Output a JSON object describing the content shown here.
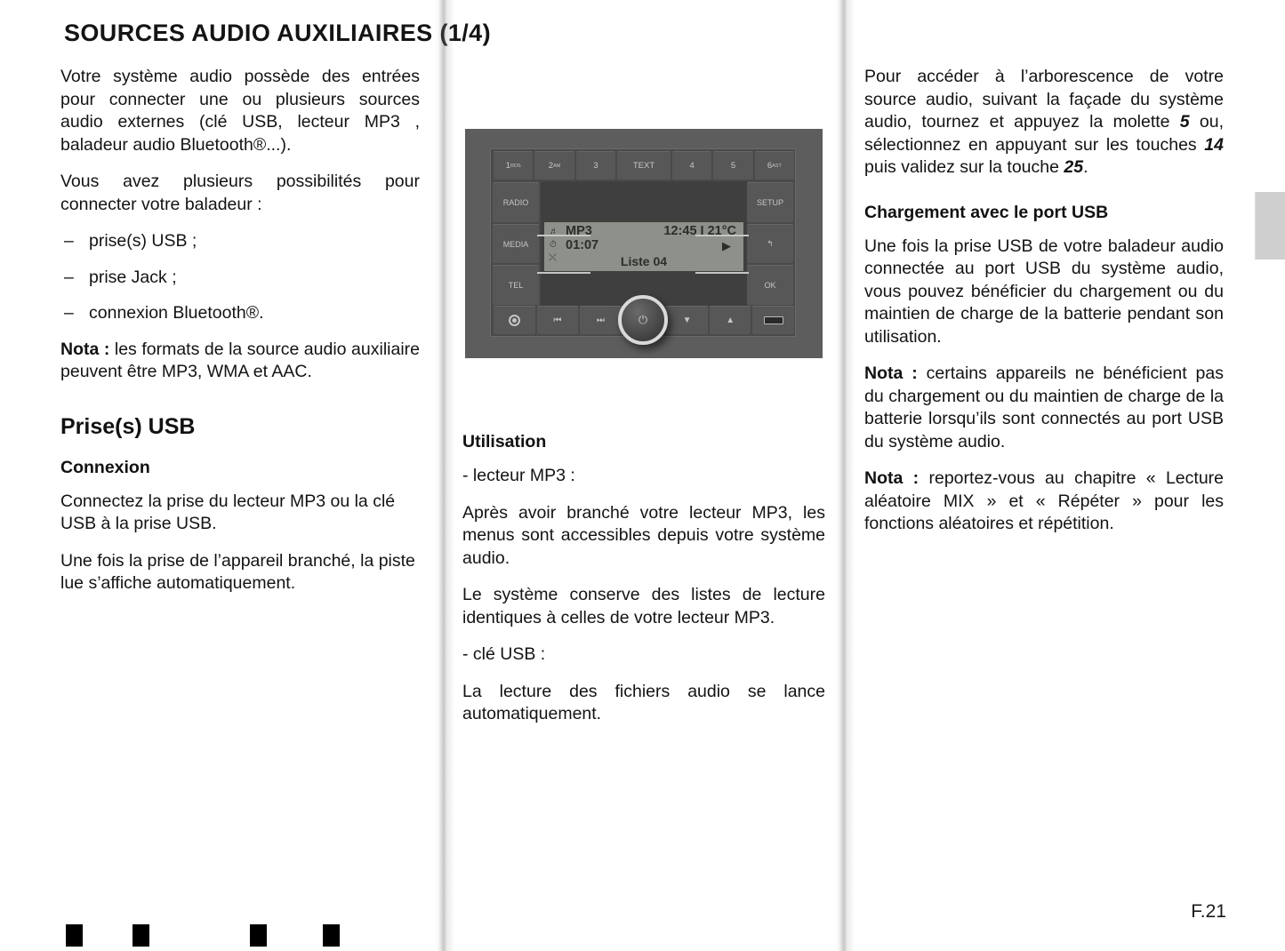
{
  "document": {
    "title": "SOURCES AUDIO AUXILIAIRES (1/4)",
    "folio": "F.21"
  },
  "column_left": {
    "intro": "Votre système audio possède des entrées pour connecter une ou plusieurs sources audio externes (clé USB, lecteur MP3 , baladeur audio Bluetooth®...).",
    "possibilities": "Vous avez plusieurs possibilités pour connecter votre baladeur :",
    "bullets": [
      {
        "dash": "–",
        "text": "prise(s) USB ;"
      },
      {
        "dash": "–",
        "text": "prise Jack ;"
      },
      {
        "dash": "–",
        "text": "connexion Bluetooth®."
      }
    ],
    "nota_label": "Nota :",
    "nota_text": " les formats de la source audio auxiliaire peuvent être MP3, WMA et AAC.",
    "section_heading": "Prise(s) USB",
    "sub_heading": "Connexion",
    "connect_p1": "Connectez la prise du lecteur MP3 ou la clé USB à la prise USB.",
    "connect_p2": "Une fois la prise de l’appareil branché, la piste lue s’affiche automatiquement."
  },
  "column_middle": {
    "radio": {
      "preset_buttons": [
        {
          "label": "1",
          "sup": "RDS"
        },
        {
          "label": "2",
          "sup": "AM"
        },
        {
          "label": "3",
          "sup": ""
        },
        {
          "label": "TEXT",
          "sup": ""
        },
        {
          "label": "4",
          "sup": ""
        },
        {
          "label": "5",
          "sup": ""
        },
        {
          "label": "6",
          "sup": "AST"
        }
      ],
      "left_buttons": [
        "RADIO",
        "MEDIA",
        "TEL"
      ],
      "right_buttons": [
        "SETUP",
        "↰",
        "OK"
      ],
      "bottom_buttons": [
        "source-dial-icon",
        "⏮",
        "⏭",
        "power-knob",
        "▼",
        "▲",
        "usb-port-icon"
      ],
      "display": {
        "source": "MP3",
        "track_time": "01:07",
        "clock_temp": "12:45 I 21°C",
        "play_icon": "▶",
        "list": "Liste 04",
        "mix_icon": "⤬"
      },
      "power_icon": "⏻"
    },
    "sub_heading": "Utilisation",
    "item_mp3": "- lecteur MP3 :",
    "mp3_p1": "Après avoir branché votre lecteur MP3, les menus sont accessibles depuis votre système audio.",
    "mp3_p2": "Le système conserve des listes de lecture identiques à celles de votre lecteur MP3.",
    "item_usb": "- clé USB :",
    "usb_p1": "La lecture des fichiers audio se lance automatiquement."
  },
  "column_right": {
    "access_p1_a": "Pour accéder à l’arborescence de votre source audio, suivant la façade du système audio, tournez et appuyez la molette ",
    "access_ref_1": "5",
    "access_p1_b": " ou, sélectionnez en appuyant sur les touches ",
    "access_ref_2": "14",
    "access_p1_c": " puis validez sur la touche ",
    "access_ref_3": "25",
    "access_p1_d": ".",
    "sub_heading": "Chargement avec le port USB",
    "charge_p1": "Une fois la prise USB de votre baladeur audio connectée au port USB du système audio, vous pouvez bénéficier du chargement ou du maintien de charge de la batterie pendant son utilisation.",
    "nota1_label": "Nota :",
    "nota1_text": " certains appareils ne bénéficient pas du chargement ou du maintien de charge de la batterie lorsqu’ils sont connectés au port USB du système audio.",
    "nota2_label": "Nota :",
    "nota2_text": " reportez-vous au chapitre « Lecture aléatoire MIX » et « Répéter » pour les fonctions aléatoires et répétition."
  },
  "colors": {
    "text": "#131313",
    "radio_body": "#5d5d5d",
    "lcd_background": "#8e9189",
    "edge_tab": "#cfcfcf"
  }
}
